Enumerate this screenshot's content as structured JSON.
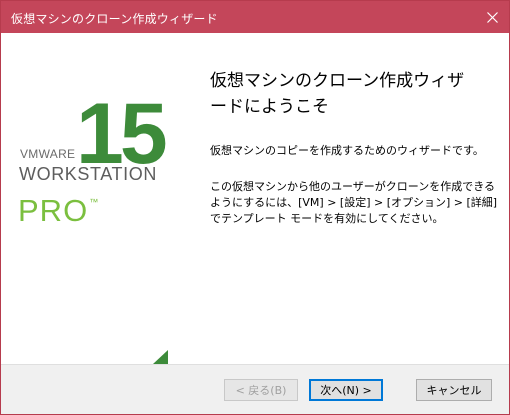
{
  "window": {
    "title": "仮想マシンのクローン作成ウィザード",
    "accent_color": "#c4465a"
  },
  "logo": {
    "version": "15",
    "brand": "VMWARE",
    "product": "WORKSTATION",
    "edition": "PRO",
    "trademark": "™",
    "green_color": "#3d8b3a",
    "light_green_color": "#7bbf3f"
  },
  "content": {
    "heading": "仮想マシンのクローン作成ウィザードにようこそ",
    "paragraph1": "仮想マシンのコピーを作成するためのウィザードです。",
    "paragraph2": "この仮想マシンから他のユーザーがクローンを作成できるようにするには、[VM] > [設定] > [オプション] > [詳細] でテンプレート モードを有効にしてください。"
  },
  "buttons": {
    "back": "< 戻る(B)",
    "next": "次へ(N) >",
    "cancel": "キャンセル"
  },
  "icons": {
    "close": "close-icon"
  }
}
